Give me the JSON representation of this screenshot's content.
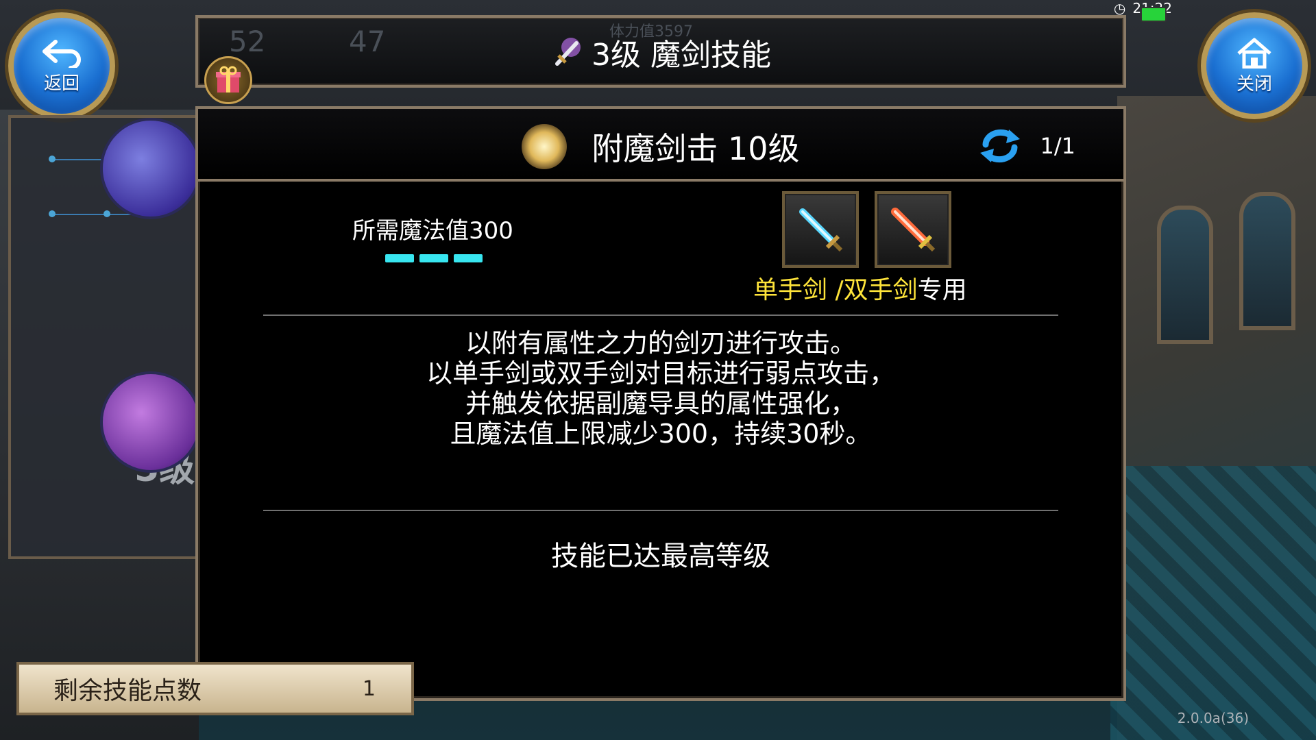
{
  "status": {
    "time": "21:22"
  },
  "hud_background": {
    "left_value": "52",
    "right_value": "47",
    "stamina_text": "体力值3597"
  },
  "header": {
    "title": "3级 魔剑技能"
  },
  "nav": {
    "back_label": "返回",
    "close_label": "关闭"
  },
  "left_panel": {
    "level_tag": "5级"
  },
  "skill": {
    "name": "附魔剑击 10级",
    "page": "1/1",
    "mana_cost": "所需魔法值300",
    "mana_segments": 3,
    "weapon_note_highlight": "单手剑 /双手剑",
    "weapon_note_tail": "专用",
    "description": [
      "以附有属性之力的剑刃进行攻击。",
      "以单手剑或双手剑对目标进行弱点攻击，",
      "并触发依据副魔导具的属性强化，",
      "且魔法值上限减少300，持续30秒。"
    ],
    "status": "技能已达最高等级"
  },
  "points": {
    "label": "剩余技能点数",
    "value": "1"
  },
  "version": "2.0.0a(36)",
  "colors": {
    "accent_cyan": "#38e6f0",
    "highlight_yellow": "#ffe53a",
    "frame": "#8a7a66"
  }
}
